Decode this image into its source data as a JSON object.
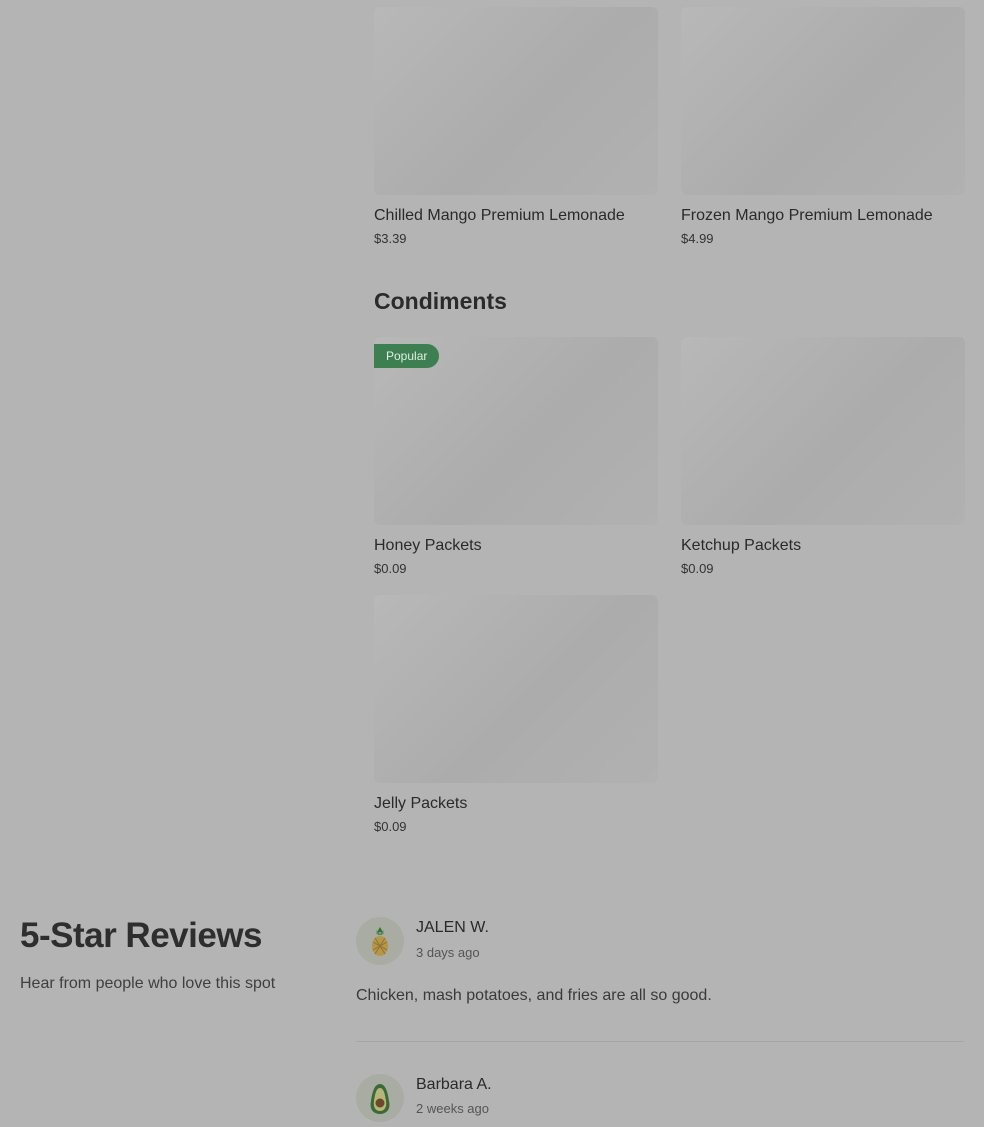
{
  "menu": {
    "drinks": [
      {
        "name": "Chilled Mango Premium Lemonade",
        "price": "$3.39"
      },
      {
        "name": "Frozen Mango Premium Lemonade",
        "price": "$4.99"
      }
    ],
    "condiments_title": "Condiments",
    "condiments": [
      {
        "name": "Honey Packets",
        "price": "$0.09",
        "badge": "Popular"
      },
      {
        "name": "Ketchup Packets",
        "price": "$0.09"
      },
      {
        "name": "Jelly Packets",
        "price": "$0.09"
      }
    ]
  },
  "reviews": {
    "title": "5-Star Reviews",
    "subtitle": "Hear from people who love this spot",
    "items": [
      {
        "name": "JALEN W.",
        "time": "3 days ago",
        "text": "Chicken, mash potatoes, and fries are all so good.",
        "avatar_icon": "pineapple-icon"
      },
      {
        "name": "Barbara A.",
        "time": "2 weeks ago",
        "avatar_icon": "avocado-icon"
      }
    ]
  }
}
